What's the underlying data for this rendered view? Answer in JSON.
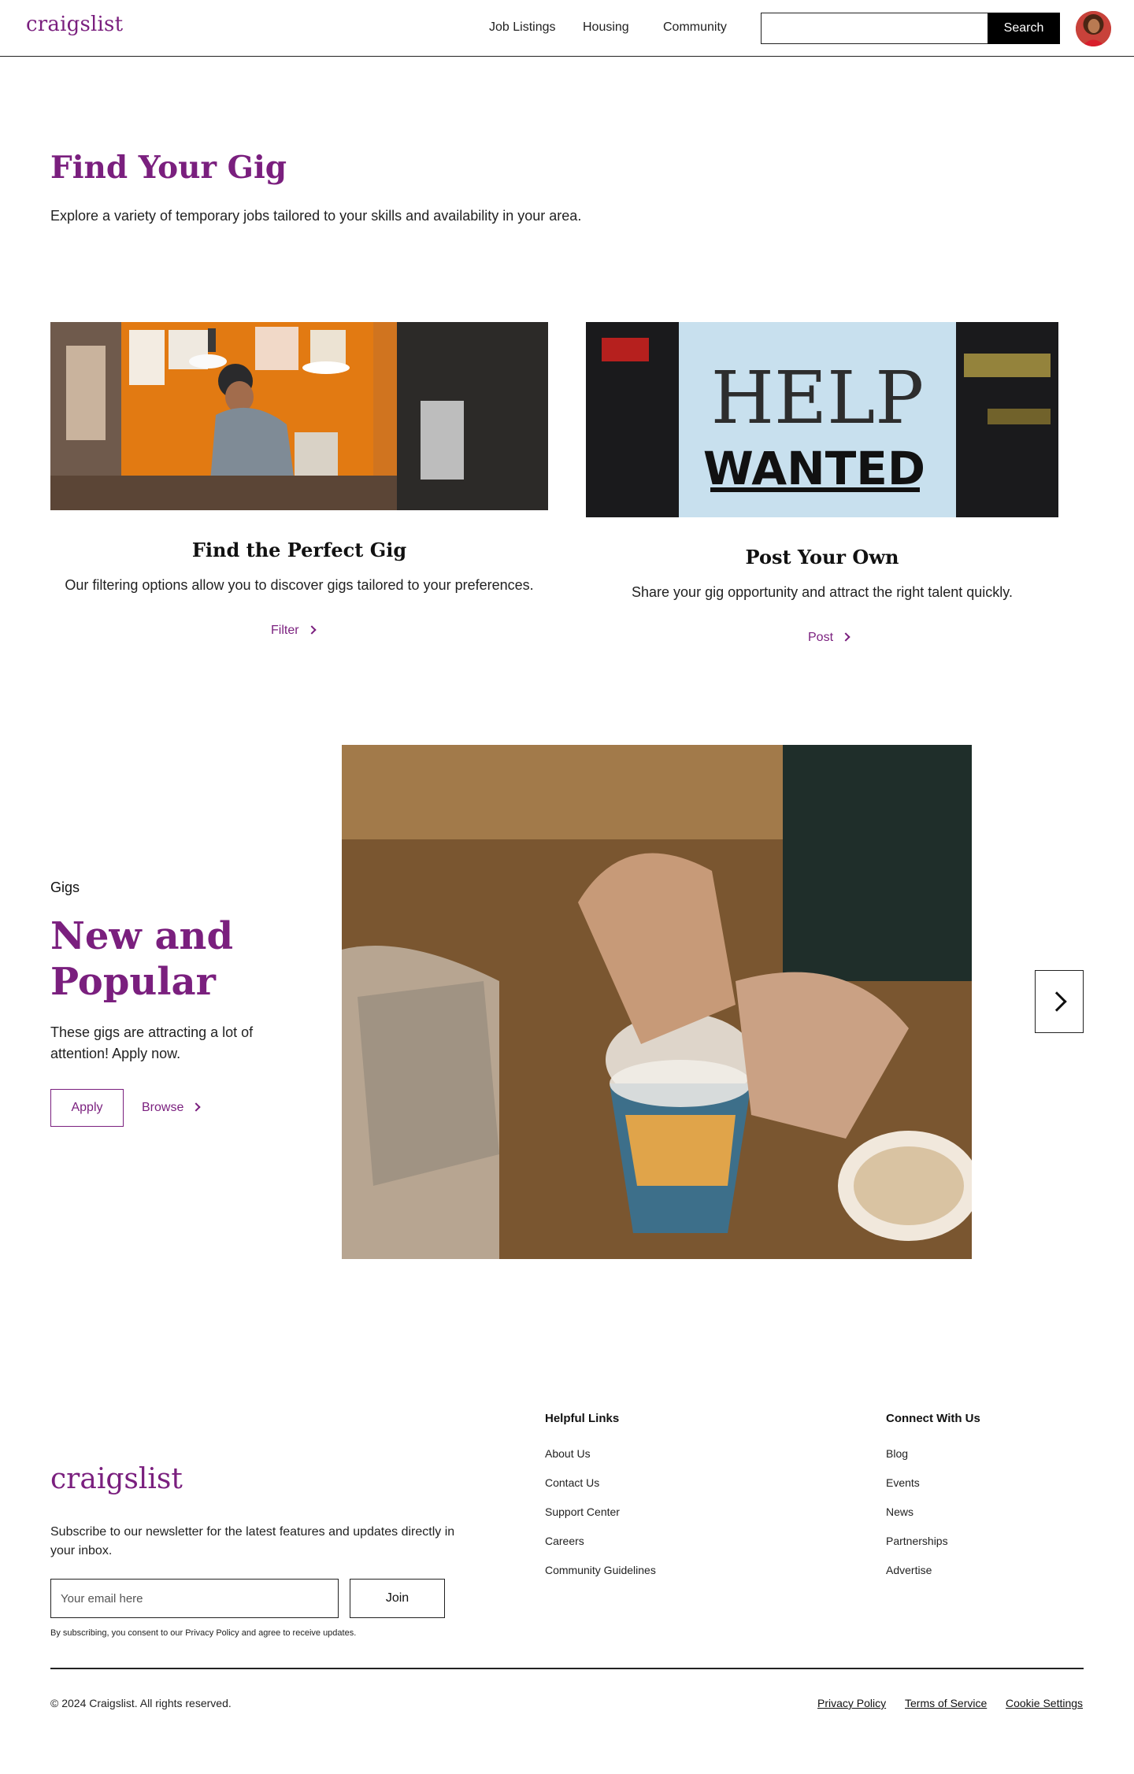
{
  "header": {
    "logo": "craigslist",
    "nav": [
      "Job Listings",
      "Housing",
      "Community"
    ],
    "search": {
      "value": "",
      "button_label": "Search"
    }
  },
  "hero": {
    "title": "Find Your Gig",
    "subtitle": "Explore a variety of temporary jobs tailored to your skills and availability in your area."
  },
  "cards": [
    {
      "title": "Find the Perfect Gig",
      "description": "Our filtering options allow you to discover gigs tailored to your preferences.",
      "link_label": "Filter"
    },
    {
      "title": "Post Your Own",
      "description": "Share your gig opportunity and attract the right talent quickly.",
      "link_label": "Post",
      "sign_text": {
        "line1": "HELP",
        "line2": "WANTED"
      }
    }
  ],
  "popular": {
    "label": "Gigs",
    "title": "New and Popular",
    "description": "These gigs are attracting a lot of attention! Apply now.",
    "apply_label": "Apply",
    "browse_label": "Browse"
  },
  "footer": {
    "logo": "craigslist",
    "newsletter_text": "Subscribe to our newsletter for the latest features and updates directly in your inbox.",
    "email_placeholder": "Your email here",
    "join_label": "Join",
    "consent": "By subscribing, you consent to our Privacy Policy and agree to receive updates.",
    "helpful_links": {
      "title": "Helpful Links",
      "items": [
        "About Us",
        "Contact Us",
        "Support Center",
        "Careers",
        "Community Guidelines"
      ]
    },
    "connect": {
      "title": "Connect With Us",
      "items": [
        "Blog",
        "Events",
        "News",
        "Partnerships",
        "Advertise"
      ]
    },
    "copyright": "© 2024 Craigslist. All rights reserved.",
    "legal": [
      "Privacy Policy",
      "Terms of Service",
      "Cookie Settings"
    ]
  },
  "colors": {
    "brand": "#7a1f7e",
    "text": "#111111",
    "border": "#222222"
  }
}
